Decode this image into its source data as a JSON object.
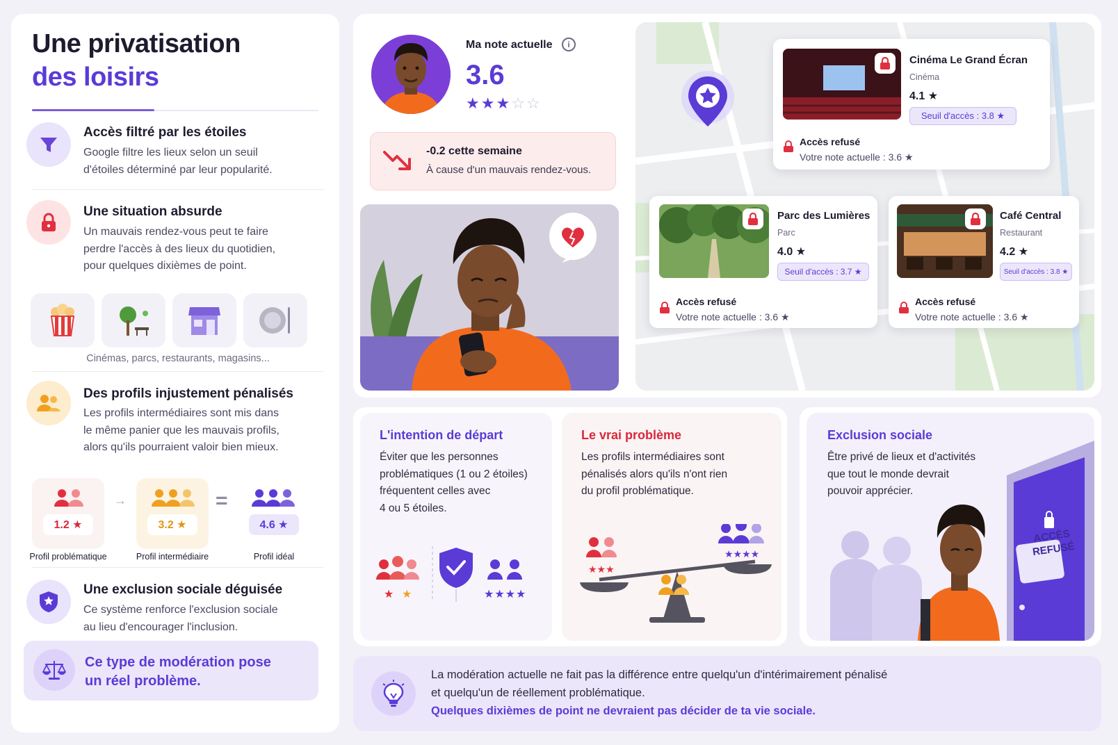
{
  "left": {
    "title_line1": "Une privatisation",
    "title_line2": "des loisirs",
    "features": [
      {
        "title": "Accès filtré par les étoiles",
        "lines": [
          "Google filtre les lieux selon un seuil",
          "d'étoiles déterminé par leur popularité."
        ]
      },
      {
        "title": "Une situation absurde",
        "lines": [
          "Un mauvais rendez-vous peut te faire",
          "perdre l'accès à des lieux du quotidien,",
          "pour quelques dixièmes de point."
        ]
      },
      {
        "title": "Des profils injustement pénalisés",
        "lines": [
          "Les profils intermédiaires sont mis dans",
          "le même panier que les mauvais profils,",
          "alors qu'ils pourraient valoir bien mieux."
        ]
      },
      {
        "title": "Une exclusion sociale déguisée",
        "lines": [
          "Ce système renforce l'exclusion sociale",
          "au lieu d'encourager l'inclusion."
        ]
      }
    ],
    "places_caption": "Cinémas, parcs, restaurants, magasins...",
    "profiles": [
      {
        "score": "1.2 ★",
        "label": "Profil problématique"
      },
      {
        "score": "3.2 ★",
        "label": "Profil intermédiaire"
      },
      {
        "score": "4.6 ★",
        "label": "Profil idéal"
      }
    ],
    "conclusion_line1": "Ce type de modération pose",
    "conclusion_line2": "un réel problème."
  },
  "rating": {
    "label": "Ma note actuelle",
    "value": "3.6",
    "stars_filled": 3,
    "stars_total": 5,
    "change_title": "-0.2 cette semaine",
    "change_text": "À cause d'un mauvais rendez-vous."
  },
  "venues": [
    {
      "name": "Cinéma Le Grand Écran",
      "category": "Cinéma",
      "rating": "4.1 ★",
      "threshold": "Seuil d'accès : 3.8 ★",
      "status": "Accès refusé",
      "current": "Votre note actuelle : 3.6 ★"
    },
    {
      "name": "Parc des Lumières",
      "category": "Parc",
      "rating": "4.0 ★",
      "threshold": "Seuil d'accès : 3.7 ★",
      "status": "Accès refusé",
      "current": "Votre note actuelle : 3.6 ★"
    },
    {
      "name": "Café Central",
      "category": "Restaurant",
      "rating": "4.2 ★",
      "threshold": "Seuil d'accès : 3.8 ★",
      "status": "Accès refusé",
      "current": "Votre note actuelle : 3.6 ★"
    }
  ],
  "cards": [
    {
      "title": "L'intention de départ",
      "lines": [
        "Éviter que les personnes",
        "problématiques (1 ou 2 étoiles)",
        "fréquentent celles avec",
        "4 ou 5 étoiles."
      ]
    },
    {
      "title": "Le vrai problème",
      "lines": [
        "Les profils intermédiaires sont",
        "pénalisés alors qu'ils n'ont rien",
        "du profil problématique."
      ]
    },
    {
      "title": "Exclusion sociale",
      "lines": [
        "Être privé de lieux et d'activités",
        "que tout le monde devrait",
        "pouvoir apprécier."
      ],
      "door_sign_line1": "ACCÈS",
      "door_sign_line2": "REFUSÉ"
    }
  ],
  "banner": {
    "line1": "La modération actuelle ne fait pas la différence entre quelqu'un d'intérimairement pénalisé",
    "line2": "et quelqu'un de réellement problématique.",
    "line3": "Quelques dixièmes de point ne devraient pas décider de ta vie sociale."
  },
  "colors": {
    "accent": "#5a3bd6",
    "danger": "#d8283a",
    "warning": "#f0a020"
  }
}
